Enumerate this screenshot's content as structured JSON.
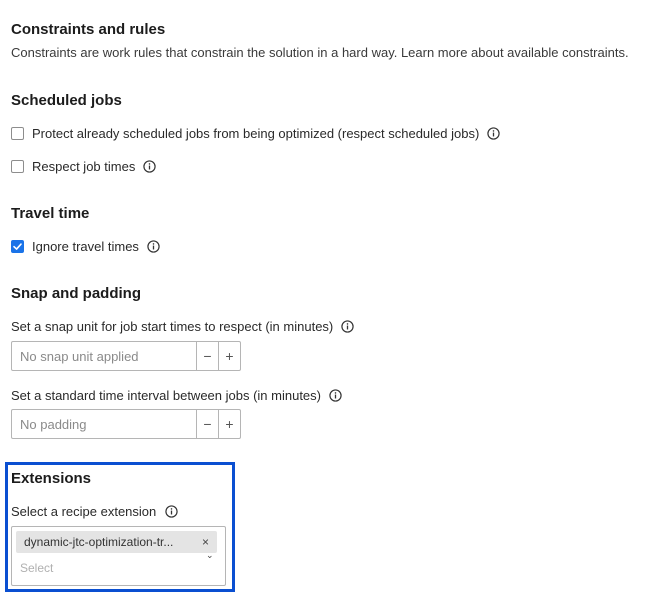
{
  "constraints": {
    "title": "Constraints and rules",
    "description": "Constraints are work rules that constrain the solution in a hard way. Learn more about available constraints."
  },
  "scheduled_jobs": {
    "title": "Scheduled jobs",
    "protect_label": "Protect already scheduled jobs from being optimized (respect scheduled jobs)",
    "protect_checked": false,
    "respect_times_label": "Respect job times",
    "respect_times_checked": false
  },
  "travel_time": {
    "title": "Travel time",
    "ignore_label": "Ignore travel times",
    "ignore_checked": true
  },
  "snap_padding": {
    "title": "Snap and padding",
    "snap_label": "Set a snap unit for job start times to respect (in minutes)",
    "snap_placeholder": "No snap unit applied",
    "padding_label": "Set a standard time interval between jobs (in minutes)",
    "padding_placeholder": "No padding",
    "minus": "−",
    "plus": "+"
  },
  "extensions": {
    "title": "Extensions",
    "select_label": "Select a recipe extension",
    "selected_tag": "dynamic-jtc-optimization-tr...",
    "remove_glyph": "×",
    "placeholder": "Select",
    "caret_glyph": "⌄"
  },
  "colors": {
    "accent": "#1a73e8",
    "highlight_border": "#0a4fd1"
  }
}
